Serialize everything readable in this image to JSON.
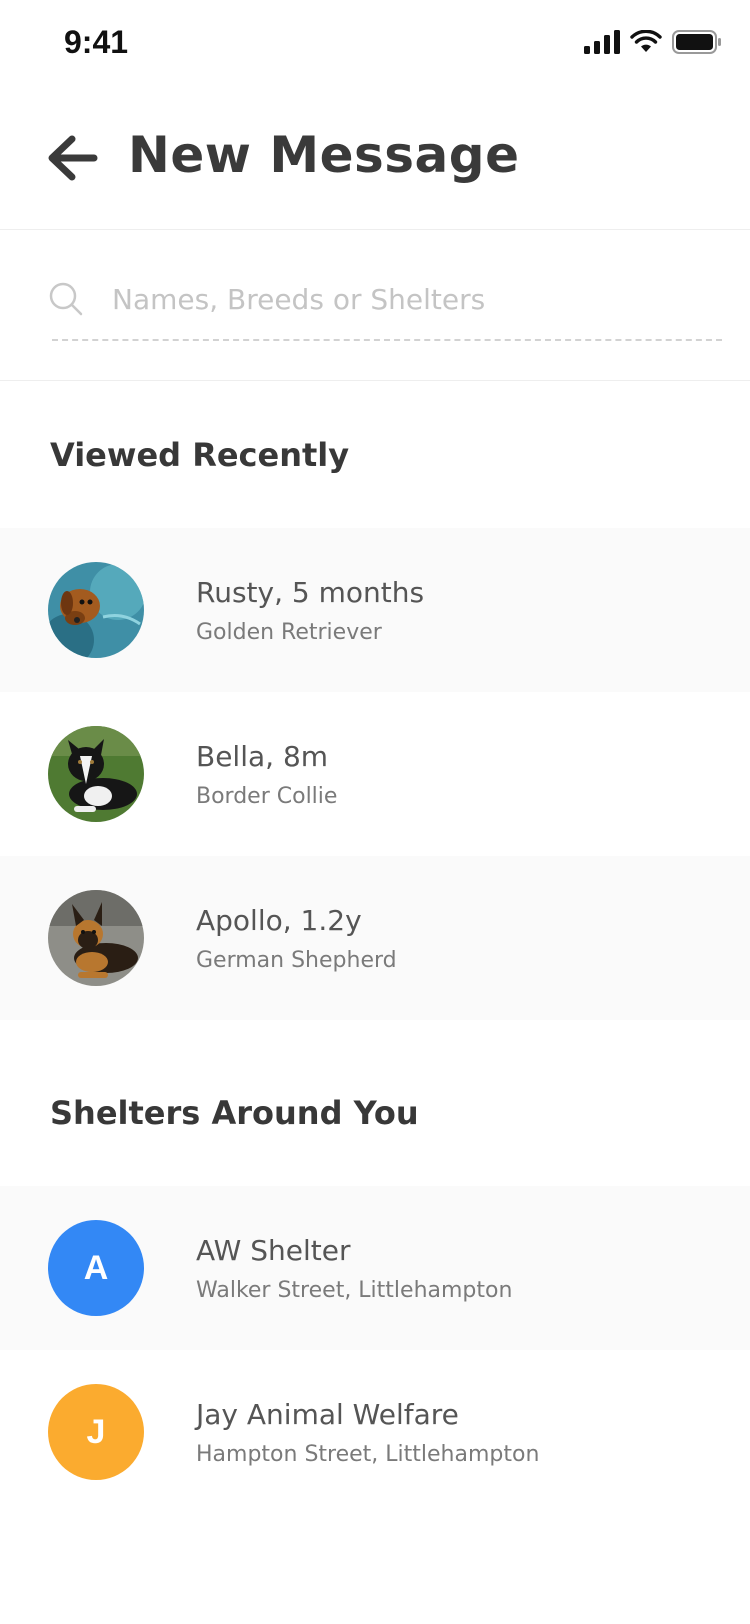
{
  "status_bar": {
    "time": "9:41"
  },
  "header": {
    "title": "New Message",
    "back_icon": "arrow-left-icon"
  },
  "search": {
    "placeholder": "Names, Breeds or Shelters",
    "value": ""
  },
  "recent": {
    "title": "Viewed Recently",
    "items": [
      {
        "name": "Rusty, 5 months",
        "breed": "Golden Retriever"
      },
      {
        "name": "Bella, 8m",
        "breed": "Border Collie"
      },
      {
        "name": "Apollo, 1.2y",
        "breed": "German Shepherd"
      }
    ]
  },
  "shelters": {
    "title": "Shelters Around You",
    "items": [
      {
        "initial": "A",
        "name": "AW Shelter",
        "address": "Walker Street, Littlehampton",
        "color": "#3388f5"
      },
      {
        "initial": "J",
        "name": "Jay Animal Welfare",
        "address": "Hampton Street, Littlehampton",
        "color": "#fbab2f"
      }
    ]
  },
  "colors": {
    "row_shade": "#fafafa",
    "title_text": "#3a3a3a",
    "sub_text": "#7a7a7a"
  }
}
